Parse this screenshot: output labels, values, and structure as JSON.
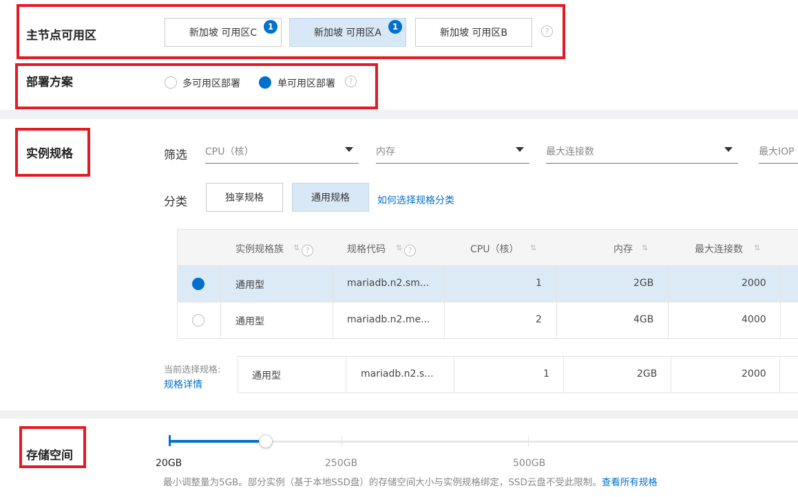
{
  "zone": {
    "title": "主节点可用区",
    "options": [
      {
        "label": "新加坡 可用区C",
        "badge": "1"
      },
      {
        "label": "新加坡 可用区A",
        "badge": "1"
      },
      {
        "label": "新加坡 可用区B"
      }
    ],
    "selected": "新加坡 可用区A"
  },
  "deploy": {
    "title": "部署方案",
    "options": [
      "多可用区部署",
      "单可用区部署"
    ],
    "selected": "单可用区部署"
  },
  "spec": {
    "title": "实例规格",
    "filter_label": "筛选",
    "filters": [
      {
        "placeholder": "CPU（核）"
      },
      {
        "placeholder": "内存"
      },
      {
        "placeholder": "最大连接数"
      },
      {
        "placeholder": "最大IOP"
      }
    ],
    "category_label": "分类",
    "categories": [
      "独享规格",
      "通用规格"
    ],
    "selected_category": "通用规格",
    "category_help_link": "如何选择规格分类",
    "table": {
      "headers": [
        "实例规格族",
        "规格代码",
        "CPU（核）",
        "内存",
        "最大连接数"
      ],
      "rows": [
        {
          "selected": true,
          "family": "通用型",
          "code": "mariadb.n2.sm...",
          "cpu": "1",
          "memory": "2GB",
          "conn": "2000"
        },
        {
          "selected": false,
          "family": "通用型",
          "code": "mariadb.n2.me...",
          "cpu": "2",
          "memory": "4GB",
          "conn": "4000"
        }
      ]
    },
    "current": {
      "label": "当前选择规格:",
      "details_link": "规格详情",
      "family": "通用型",
      "code": "mariadb.n2.s...",
      "cpu": "1",
      "memory": "2GB",
      "conn": "2000"
    }
  },
  "storage": {
    "title": "存储空间",
    "value_gb": 20,
    "ticks": [
      "20GB",
      "250GB",
      "500GB"
    ],
    "note": "最小调整量为5GB。部分实例（基于本地SSD盘）的存储空间大小与实例规格绑定，SSD云盘不受此限制。",
    "note_link": "查看所有规格"
  },
  "colors": {
    "accent": "#0070cc",
    "highlight": "#e41923",
    "selected_bg": "#d8e8f6"
  }
}
